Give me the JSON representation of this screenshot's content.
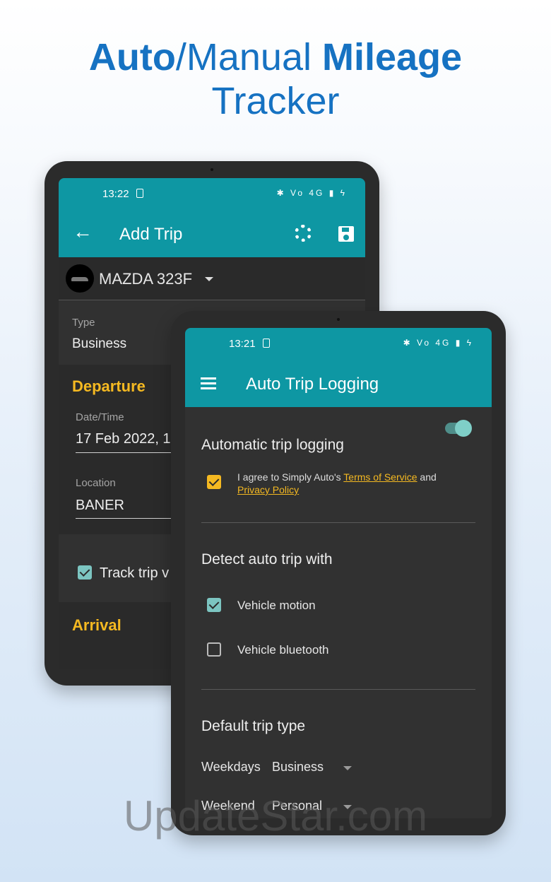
{
  "headline": {
    "line1_bold1": "Auto",
    "line1_normal": "/Manual ",
    "line1_bold2": "Mileage",
    "line2": "Tracker"
  },
  "back_tablet": {
    "status_time": "13:22",
    "status_icons": "✱ Vo 4G ▮ ϟ",
    "app_title": "Add Trip",
    "back_icon": "←",
    "vehicle_name": "MAZDA 323F",
    "type_label": "Type",
    "type_value": "Business",
    "departure_heading": "Departure",
    "datetime_label": "Date/Time",
    "datetime_value": "17 Feb 2022, 1",
    "location_label": "Location",
    "location_value": "BANER",
    "track_trip_label": "Track trip v",
    "arrival_heading": "Arrival"
  },
  "front_tablet": {
    "status_time": "13:21",
    "status_icons": "✱ Vo 4G ▮ ϟ",
    "app_title": "Auto Trip Logging",
    "auto_logging_label": "Automatic trip logging",
    "auto_logging_enabled": true,
    "agree_prefix": "I agree to Simply Auto's ",
    "terms_link": "Terms of Service",
    "agree_and": " and",
    "privacy_link": "Privacy Policy",
    "detect_heading": "Detect auto trip with",
    "vehicle_motion_label": "Vehicle motion",
    "vehicle_motion_checked": true,
    "vehicle_bluetooth_label": "Vehicle bluetooth",
    "vehicle_bluetooth_checked": false,
    "default_type_heading": "Default trip type",
    "weekdays_label": "Weekdays",
    "weekdays_value": "Business",
    "weekend_label": "Weekend",
    "weekend_value": "Personal"
  },
  "watermark": "UpdateStar.com",
  "colors": {
    "teal": "#0e97a3",
    "accent_yellow": "#f5b921",
    "headline_blue": "#1672c2",
    "screen_bg": "#313131"
  }
}
